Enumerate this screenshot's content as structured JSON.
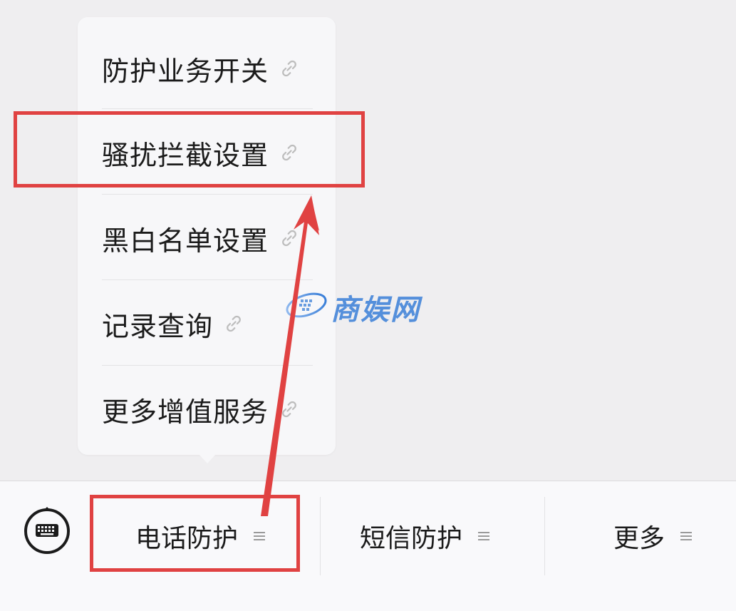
{
  "popup_menu": {
    "items": [
      {
        "label": "防护业务开关"
      },
      {
        "label": "骚扰拦截设置"
      },
      {
        "label": "黑白名单设置"
      },
      {
        "label": "记录查询"
      },
      {
        "label": "更多增值服务"
      }
    ]
  },
  "bottom_bar": {
    "tabs": [
      {
        "label": "电话防护"
      },
      {
        "label": "短信防护"
      },
      {
        "label": "更多"
      }
    ]
  },
  "watermark": {
    "text": "商娱网"
  },
  "colors": {
    "highlight": "#e04242",
    "watermark": "#3a7fd8"
  },
  "icons": {
    "item_icon": "link-icon",
    "tab_icon": "menu-lines-icon",
    "keyboard": "keyboard-icon"
  }
}
